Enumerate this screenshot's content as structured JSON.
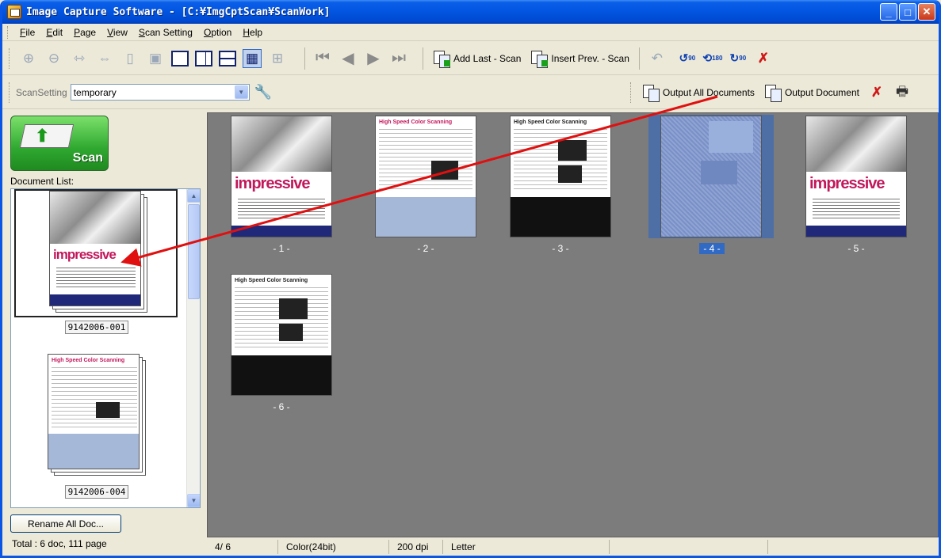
{
  "window": {
    "title": "Image Capture Software - [C:¥ImgCptScan¥ScanWork]"
  },
  "menu": [
    {
      "label": "File",
      "u": "F",
      "rest": "ile"
    },
    {
      "label": "Edit",
      "u": "E",
      "rest": "dit"
    },
    {
      "label": "Page",
      "u": "P",
      "rest": "age"
    },
    {
      "label": "View",
      "u": "V",
      "rest": "iew"
    },
    {
      "label": "Scan Setting",
      "u": "S",
      "rest": "can Setting"
    },
    {
      "label": "Option",
      "u": "O",
      "rest": "ption"
    },
    {
      "label": "Help",
      "u": "H",
      "rest": "elp"
    }
  ],
  "toolbar": {
    "add_last_scan": "Add Last - Scan",
    "insert_prev_scan": "Insert Prev. - Scan",
    "rotate_left": "90",
    "rotate_180": "180",
    "rotate_right": "90"
  },
  "scan_setting": {
    "label": "ScanSetting",
    "value": "temporary",
    "output_all": "Output All Documents",
    "output_doc": "Output Document"
  },
  "left": {
    "scan_button": "Scan",
    "doclist_label": "Document List:",
    "documents": [
      "9142006-001",
      "9142006-004"
    ],
    "rename_button": "Rename All Doc...",
    "total": "Total :  6 doc, 111 page"
  },
  "pages": [
    {
      "num": "- 1 -",
      "text": "impressive"
    },
    {
      "num": "- 2 -",
      "text": "High Speed Color Scanning"
    },
    {
      "num": "- 3 -",
      "text": "High Speed Color Scanning"
    },
    {
      "num": "- 4 -",
      "text": ""
    },
    {
      "num": "- 5 -",
      "text": "impressive"
    },
    {
      "num": "- 6 -",
      "text": "High Speed Color Scanning"
    }
  ],
  "status": {
    "page": "4/  6",
    "color": "Color(24bit)",
    "dpi": "200 dpi",
    "size": "Letter"
  },
  "colors": {
    "accent": "#316ac5",
    "arrow": "#e01010",
    "title_bar": "#0255e0"
  }
}
